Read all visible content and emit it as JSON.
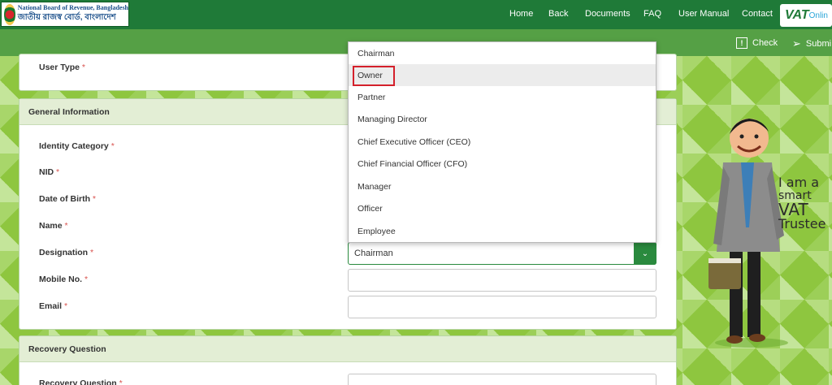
{
  "header": {
    "org_name_en": "National Board of Revenue, Bangladesh",
    "org_name_bn": "জাতীয় রাজস্ব বোর্ড, বাংলাদেশ",
    "nav": [
      "Home",
      "Back",
      "Documents",
      "FAQ",
      "User Manual",
      "Contact"
    ],
    "vat_logo_main": "VAT",
    "vat_logo_sub": "Onlin"
  },
  "toolbar": {
    "check": "Check",
    "submit": "Submi"
  },
  "user_type": {
    "label": "User Type",
    "req": "*"
  },
  "general": {
    "title": "General Information",
    "fields": {
      "identity_category": "Identity Category",
      "nid": "NID",
      "dob": "Date of Birth",
      "name": "Name",
      "designation": "Designation",
      "mobile": "Mobile No.",
      "email": "Email"
    },
    "req": "*"
  },
  "designation_select": {
    "value": "Chairman"
  },
  "dropdown": {
    "options": [
      "Chairman",
      "Owner",
      "Partner",
      "Managing Director",
      "Chief Executive Officer (CEO)",
      "Chief Financial Officer (CFO)",
      "Manager",
      "Officer",
      "Employee"
    ],
    "highlighted": "Owner"
  },
  "recovery": {
    "title": "Recovery Question",
    "question_label": "Recovery Question",
    "req": "*"
  },
  "mascot": {
    "slogan": [
      "I am a",
      "smart",
      "VAT",
      "Trustee"
    ]
  },
  "colors": {
    "nav_green": "#1f7a38",
    "accent": "#2a8a3e",
    "highlight_border": "#d4202b"
  }
}
